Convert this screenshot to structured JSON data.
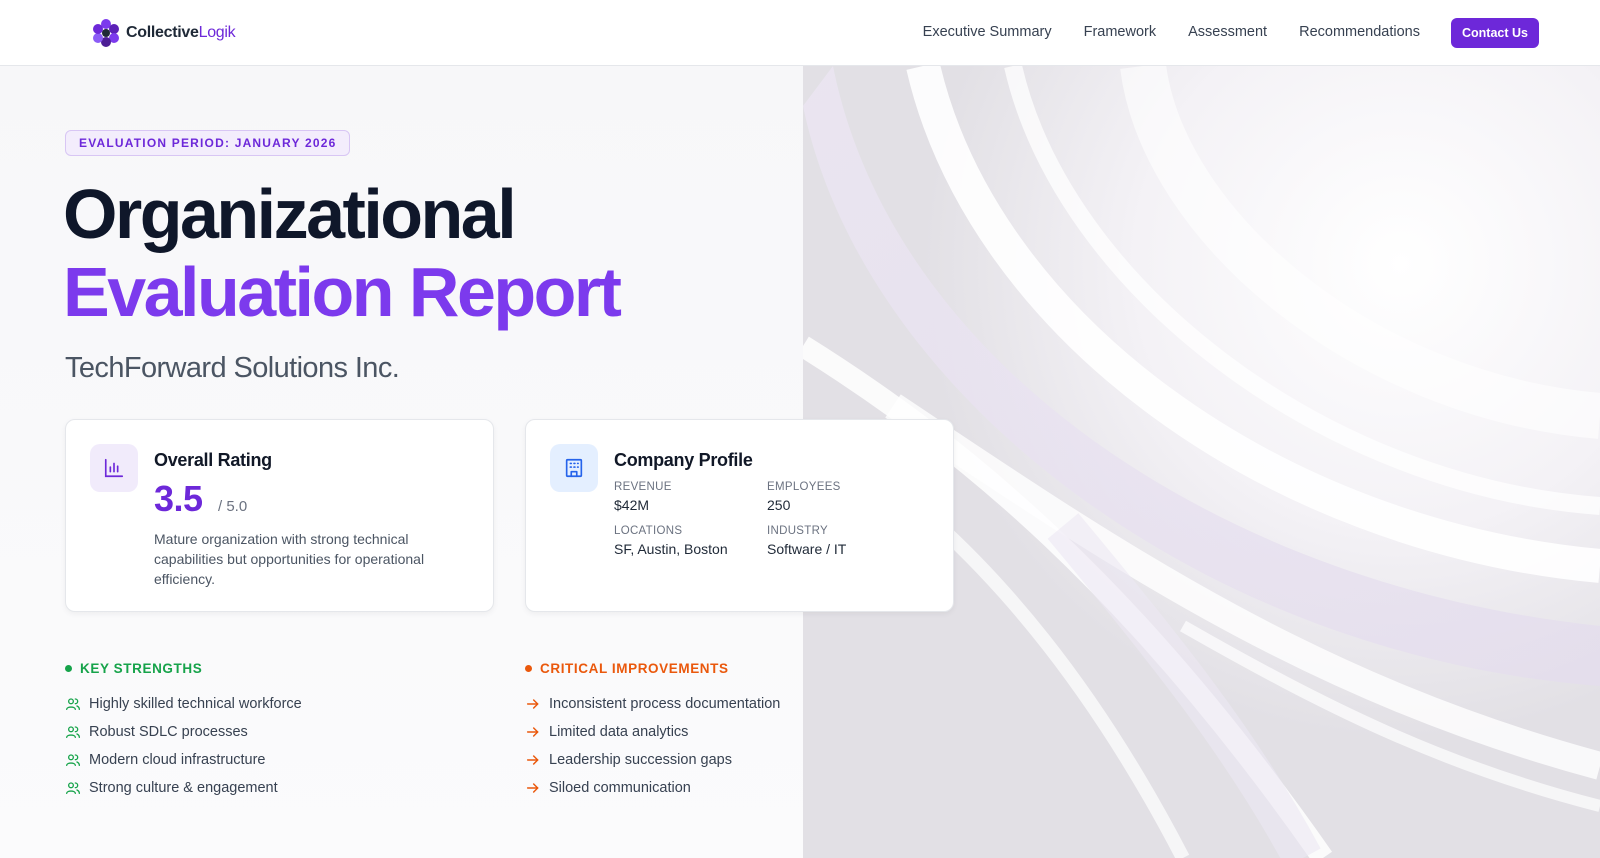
{
  "brand": {
    "name_primary": "Collective",
    "name_accent": "Logik",
    "colors": {
      "primary": "#6d28d9",
      "accent": "#7c3aed",
      "strength": "#16a34a",
      "improvement": "#ea580c"
    }
  },
  "nav": {
    "links": [
      "Executive Summary",
      "Framework",
      "Assessment",
      "Recommendations"
    ],
    "cta": "Contact Us"
  },
  "hero": {
    "badge": "EVALUATION PERIOD: JANUARY 2026",
    "title_line1": "Organizational",
    "title_line2": "Evaluation Report",
    "company": "TechForward Solutions Inc."
  },
  "rating_card": {
    "icon": "bar-chart-icon",
    "title": "Overall Rating",
    "value": "3.5",
    "scale": "/ 5.0",
    "description": "Mature organization with strong technical capabilities but opportunities for operational efficiency."
  },
  "profile_card": {
    "icon": "building-icon",
    "title": "Company Profile",
    "items": [
      {
        "label": "REVENUE",
        "value": "$42M"
      },
      {
        "label": "EMPLOYEES",
        "value": "250"
      },
      {
        "label": "LOCATIONS",
        "value": "SF, Austin, Boston"
      },
      {
        "label": "INDUSTRY",
        "value": "Software / IT"
      }
    ]
  },
  "strengths": {
    "heading": "KEY STRENGTHS",
    "icon": "users-icon",
    "items": [
      "Highly skilled technical workforce",
      "Robust SDLC processes",
      "Modern cloud infrastructure",
      "Strong culture & engagement"
    ]
  },
  "improvements": {
    "heading": "CRITICAL IMPROVEMENTS",
    "icon": "arrow-right-icon",
    "items": [
      "Inconsistent process documentation",
      "Limited data analytics",
      "Leadership succession gaps",
      "Siloed communication"
    ]
  }
}
